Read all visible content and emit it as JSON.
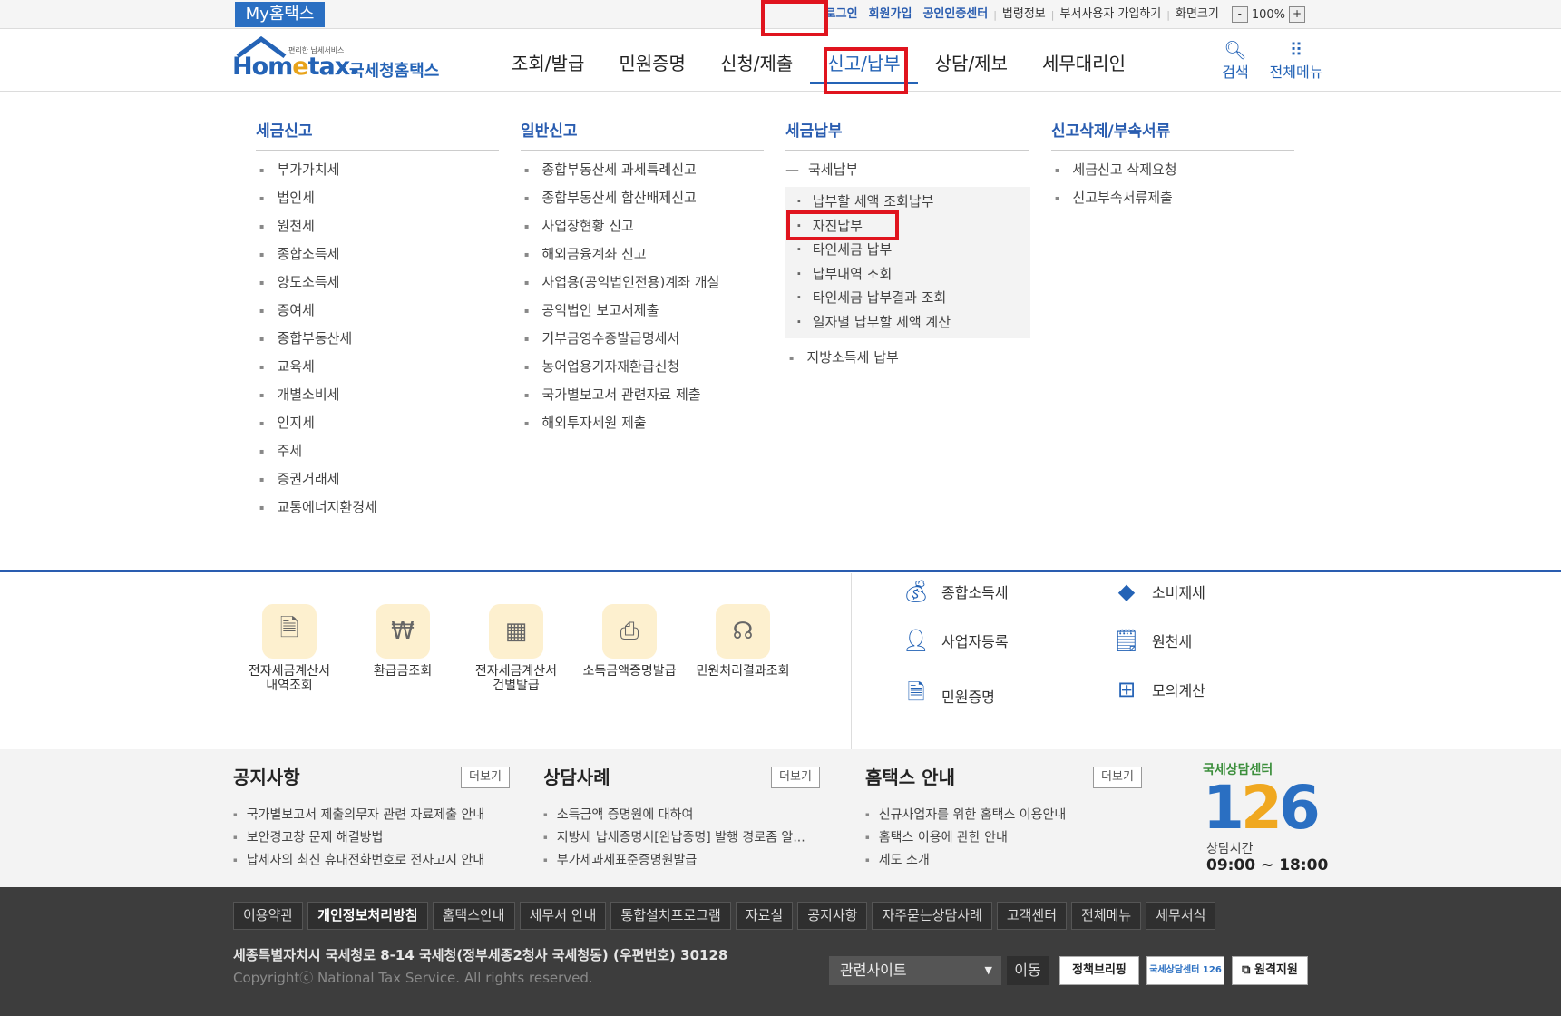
{
  "topbar": {
    "my_hometax": "My홈택스",
    "links": [
      "로그인",
      "회원가입",
      "공인인증센터",
      "법령정보",
      "부서사용자 가입하기",
      "화면크기"
    ],
    "zoom_minus": "-",
    "zoom_level": "100%",
    "zoom_plus": "+"
  },
  "header": {
    "logo_sub": "편리한 납세서비스",
    "logo_main_a": "Hom",
    "logo_main_e": "e",
    "logo_main_b": "tax.",
    "logo_kr": "국세청홈택스",
    "gnb": [
      "조회/발급",
      "민원증명",
      "신청/제출",
      "신고/납부",
      "상담/제보",
      "세무대리인"
    ],
    "search_label": "검색",
    "allmenu_label": "전체메뉴",
    "search_icon": "magnifier-icon",
    "allmenu_icon": "grid-icon"
  },
  "megamenu": {
    "col1": {
      "title": "세금신고",
      "items": [
        "부가가치세",
        "법인세",
        "원천세",
        "종합소득세",
        "양도소득세",
        "증여세",
        "종합부동산세",
        "교육세",
        "개별소비세",
        "인지세",
        "주세",
        "증권거래세",
        "교통에너지환경세"
      ]
    },
    "col2": {
      "title": "일반신고",
      "items": [
        "종합부동산세 과세특례신고",
        "종합부동산세 합산배제신고",
        "사업장현황 신고",
        "해외금융계좌 신고",
        "사업용(공익법인전용)계좌 개설",
        "공익법인 보고서제출",
        "기부금영수증발급명세서",
        "농어업용기자재환급신청",
        "국가별보고서 관련자료 제출",
        "해외투자세원 제출"
      ]
    },
    "col3": {
      "title": "세금납부",
      "group_label": "국세납부",
      "sub_items": [
        "납부할 세액 조회납부",
        "자진납부",
        "타인세금 납부",
        "납부내역 조회",
        "타인세금 납부결과 조회",
        "일자별 납부할 세액 계산"
      ],
      "extra_item": "지방소득세 납부"
    },
    "col4": {
      "title": "신고삭제/부속서류",
      "items": [
        "세금신고 삭제요청",
        "신고부속서류제출"
      ]
    }
  },
  "quick": {
    "icons": [
      {
        "label1": "전자세금계산서",
        "label2": "내역조회",
        "icon": "invoice-search-icon"
      },
      {
        "label1": "환급금조회",
        "label2": "",
        "icon": "refund-coin-icon"
      },
      {
        "label1": "전자세금계산서",
        "label2": "건별발급",
        "icon": "calculator-icon"
      },
      {
        "label1": "소득금액증명발급",
        "label2": "",
        "icon": "printer-icon"
      },
      {
        "label1": "민원처리결과조회",
        "label2": "",
        "icon": "headset-icon"
      }
    ],
    "right": [
      {
        "label": "종합소득세",
        "icon": "money-bag-icon"
      },
      {
        "label": "소비제세",
        "icon": "diamond-icon"
      },
      {
        "label": "사업자등록",
        "icon": "person-icon"
      },
      {
        "label": "원천세",
        "icon": "salary-doc-icon"
      },
      {
        "label": "민원증명",
        "icon": "document-icon"
      },
      {
        "label": "모의계산",
        "icon": "calc-icon"
      }
    ]
  },
  "board": {
    "notice": {
      "title": "공지사항",
      "more": "더보기",
      "items": [
        "국가별보고서 제출의무자 관련 자료제출 안내",
        "보안경고창 문제 해결방법",
        "납세자의 최신 휴대전화번호로 전자고지 안내"
      ]
    },
    "cases": {
      "title": "상담사례",
      "more": "더보기",
      "items": [
        "소득금액 증명원에 대하여",
        "지방세 납세증명서[완납증명] 발행 경로좀 알...",
        "부가세과세표준증명원발급"
      ]
    },
    "guide": {
      "title": "홈택스 안내",
      "more": "더보기",
      "items": [
        "신규사업자를 위한 홈택스 이용안내",
        "홈택스 이용에 관한 안내",
        "제도 소개"
      ]
    },
    "center": {
      "brand": "국세상담센터",
      "num_a": "1",
      "num_b": "2",
      "num_c": "6",
      "hours_label": "상담시간",
      "hours": "09:00 ~ 18:00"
    }
  },
  "footer": {
    "links": [
      "이용약관",
      "개인정보처리방침",
      "홈택스안내",
      "세무서 안내",
      "통합설치프로그램",
      "자료실",
      "공지사항",
      "자주묻는상담사례",
      "고객센터",
      "전체메뉴",
      "세무서식"
    ],
    "address": "세종특별자치시 국세청로 8-14 국세청(정부세종2청사 국세청동) (우편번호) 30128",
    "copyright": "Copyrightⓒ National Tax Service. All rights reserved.",
    "related": "관련사이트",
    "go": "이동",
    "btn1": "정책브리핑",
    "btn2": "국세상담센터 126",
    "btn3": "원격지원"
  }
}
